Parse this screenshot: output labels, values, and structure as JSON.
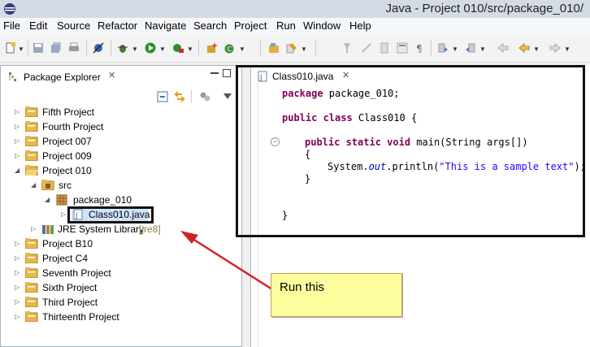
{
  "window": {
    "title": "Java - Project 010/src/package_010/"
  },
  "menu": [
    "File",
    "Edit",
    "Source",
    "Refactor",
    "Navigate",
    "Search",
    "Project",
    "Run",
    "Window",
    "Help"
  ],
  "package_explorer": {
    "tab_label": "Package Explorer",
    "close_glyph": "✕",
    "tree": [
      {
        "label": "Fifth Project",
        "level": 0,
        "type": "project",
        "expanded": false
      },
      {
        "label": "Fourth Project",
        "level": 0,
        "type": "project",
        "expanded": false
      },
      {
        "label": "Project 007",
        "level": 0,
        "type": "project",
        "expanded": false
      },
      {
        "label": "Project 009",
        "level": 0,
        "type": "project",
        "expanded": false
      },
      {
        "label": "Project 010",
        "level": 0,
        "type": "project",
        "expanded": true
      },
      {
        "label": "src",
        "level": 1,
        "type": "src",
        "expanded": true
      },
      {
        "label": "package_010",
        "level": 2,
        "type": "package",
        "expanded": true
      },
      {
        "label": "Class010.java",
        "level": 3,
        "type": "java",
        "expanded": false,
        "selected": true
      },
      {
        "label": "JRE System Library",
        "level": 1,
        "type": "library",
        "expanded": false,
        "suffix": "[jre8]"
      },
      {
        "label": "Project B10",
        "level": 0,
        "type": "project",
        "expanded": false
      },
      {
        "label": "Project C4",
        "level": 0,
        "type": "project",
        "expanded": false
      },
      {
        "label": "Seventh Project",
        "level": 0,
        "type": "project",
        "expanded": false
      },
      {
        "label": "Sixth Project",
        "level": 0,
        "type": "project",
        "expanded": false
      },
      {
        "label": "Third Project",
        "level": 0,
        "type": "project",
        "expanded": false
      },
      {
        "label": "Thirteenth Project",
        "level": 0,
        "type": "project",
        "expanded": false
      }
    ]
  },
  "editor": {
    "tab_label": "Class010.java",
    "close_glyph": "✕",
    "code": {
      "l1_kw": "package",
      "l1_rest": " package_010;",
      "l2_kw": "public class",
      "l2_rest": " Class010 {",
      "l3_kw": "public static void",
      "l3_rest": " main(String args[])",
      "l4": "{",
      "l5_a": "System.",
      "l5_out": "out",
      "l5_b": ".println(",
      "l5_str": "\"This is a sample text\"",
      "l5_c": ");",
      "l6": "}",
      "l7": "}"
    }
  },
  "annotation": {
    "note_text": "Run this"
  },
  "colors": {
    "keyword": "#7f0055",
    "string": "#2a00ff",
    "arrow": "#d42020",
    "note_bg": "#fdfd9e"
  }
}
